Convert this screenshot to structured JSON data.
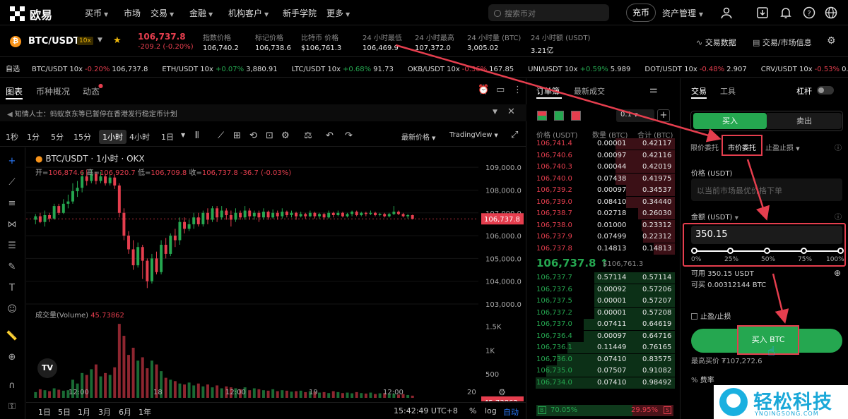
{
  "nav": {
    "brand": "欧易",
    "menu": [
      {
        "label": "买币",
        "chevron": true
      },
      {
        "label": "市场",
        "chevron": false
      },
      {
        "label": "交易",
        "chevron": true
      },
      {
        "label": "金融",
        "chevron": true
      },
      {
        "label": "机构客户",
        "chevron": true
      },
      {
        "label": "新手学院",
        "chevron": false
      },
      {
        "label": "更多",
        "chevron": true
      }
    ],
    "search_placeholder": "搜索币对",
    "deposit": "充币",
    "assets": "资产管理"
  },
  "ticker": {
    "pair": "BTC/USDT",
    "leverage": "10x",
    "price": "106,737.8",
    "change": "-209.2 (-0.20%)",
    "stats": [
      {
        "label": "指数价格",
        "value": "106,740.2"
      },
      {
        "label": "标记价格",
        "value": "106,738.6"
      },
      {
        "label": "比特币 价格",
        "value": "$106,761.3"
      },
      {
        "label": "24 小时最低",
        "value": "106,469.9"
      },
      {
        "label": "24 小时最高",
        "value": "107,372.0"
      },
      {
        "label": "24 小时量 (BTC)",
        "value": "3,005.02"
      },
      {
        "label": "24 小时额 (USDT)",
        "value": "3.21亿"
      }
    ],
    "trade_data": "交易数据",
    "trade_info": "交易/市场信息"
  },
  "watchlist": {
    "label": "自选",
    "items": [
      {
        "pair": "BTC/USDT 10x",
        "change": "-0.20%",
        "price": "106,737.8",
        "up": false
      },
      {
        "pair": "ETH/USDT 10x",
        "change": "+0.07%",
        "price": "3,880.91",
        "up": true
      },
      {
        "pair": "LTC/USDT 10x",
        "change": "+0.68%",
        "price": "91.73",
        "up": true
      },
      {
        "pair": "OKB/USDT 10x",
        "change": "-0.36%",
        "price": "167.85",
        "up": false
      },
      {
        "pair": "UNI/USDT 10x",
        "change": "+0.59%",
        "price": "5.989",
        "up": true
      },
      {
        "pair": "DOT/USDT 10x",
        "change": "-0.48%",
        "price": "2.907",
        "up": false
      },
      {
        "pair": "CRV/USDT 10x",
        "change": "-0.53%",
        "price": "0.5212",
        "up": false
      },
      {
        "pair": "AAVE/U",
        "change": "",
        "price": "",
        "up": false
      }
    ]
  },
  "chart_panel": {
    "tabs": [
      "图表",
      "币种概况",
      "动态"
    ],
    "notice": "知情人士：蚂蚁京东等已暂停在香港发行稳定币计划",
    "intervals": [
      "1秒",
      "1分",
      "5分",
      "15分",
      "1小时",
      "4小时",
      "1日"
    ],
    "active_interval": "1小时",
    "price_mode": "最新价格",
    "view_mode": "TradingView",
    "title": "BTC/USDT · 1小时 · OKX",
    "ohlc": {
      "open_label": "开=",
      "open": "106,874.6",
      "high_label": "高=",
      "high": "106,920.7",
      "low_label": "低=",
      "low": "106,709.8",
      "close_label": "收=",
      "close": "106,737.8",
      "change": "-36.7 (-0.03%)"
    },
    "volume_title": "成交量(Volume)",
    "volume_value": "45.73862",
    "price_axis": [
      "109,000.0",
      "108,000.0",
      "107,000.0",
      "106,000.0",
      "105,000.0",
      "104,000.0",
      "103,000.0"
    ],
    "current_price_tag": "106,737.8",
    "vol_axis": [
      "1.5K",
      "1K",
      "500"
    ],
    "vol_tag": "45.73862",
    "time_axis": [
      "12:00",
      "18",
      "12:00",
      "19",
      "12:00",
      "20"
    ],
    "ranges": [
      "1日",
      "5日",
      "1月",
      "3月",
      "6月",
      "1年"
    ],
    "clock": "15:42:49 UTC+8",
    "pct": "%",
    "log": "log",
    "auto": "自动"
  },
  "chart_data": {
    "type": "candlestick",
    "ylim": [
      103000,
      109500
    ],
    "candles": [
      [
        106700,
        106850,
        106500,
        106950
      ],
      [
        106850,
        106600,
        106550,
        107000
      ],
      [
        106600,
        106900,
        106400,
        107100
      ],
      [
        106900,
        106750,
        106600,
        107000
      ],
      [
        106750,
        107300,
        106700,
        107400
      ],
      [
        107300,
        107000,
        106900,
        107400
      ],
      [
        107000,
        107400,
        106950,
        107600
      ],
      [
        107400,
        107500,
        107200,
        107800
      ],
      [
        107500,
        107950,
        107400,
        108300
      ],
      [
        107950,
        108100,
        107700,
        108400
      ],
      [
        108100,
        108600,
        107900,
        108800
      ],
      [
        108600,
        108400,
        108200,
        108900
      ],
      [
        108400,
        108700,
        108300,
        108900
      ],
      [
        108700,
        108400,
        108250,
        108800
      ],
      [
        108400,
        108600,
        108300,
        108800
      ],
      [
        108600,
        108300,
        108200,
        108700
      ],
      [
        108300,
        108550,
        108200,
        108700
      ],
      [
        108550,
        108200,
        108050,
        108650
      ],
      [
        108200,
        107000,
        106800,
        108300
      ],
      [
        107000,
        106000,
        105800,
        107200
      ],
      [
        106000,
        105400,
        105200,
        106200
      ],
      [
        105400,
        104700,
        104500,
        105800
      ],
      [
        104700,
        105500,
        104600,
        105700
      ],
      [
        105500,
        104900,
        104100,
        105600
      ],
      [
        104900,
        104000,
        103700,
        105000
      ],
      [
        104000,
        105000,
        103900,
        105200
      ],
      [
        105000,
        104400,
        104300,
        105300
      ],
      [
        104400,
        105600,
        104300,
        105800
      ],
      [
        105600,
        105200,
        105000,
        105900
      ],
      [
        105200,
        106000,
        105100,
        106100
      ],
      [
        106000,
        105800,
        105500,
        106300
      ],
      [
        105800,
        106600,
        105600,
        106800
      ],
      [
        106600,
        106300,
        106100,
        106800
      ],
      [
        106300,
        106500,
        106200,
        106700
      ],
      [
        106500,
        106800,
        106300,
        107000
      ],
      [
        106800,
        106500,
        106400,
        107000
      ],
      [
        106500,
        107000,
        106400,
        107100
      ],
      [
        107000,
        106700,
        106500,
        107200
      ],
      [
        106700,
        107200,
        106600,
        107300
      ],
      [
        107200,
        106800,
        106600,
        107300
      ],
      [
        106800,
        107100,
        106700,
        107300
      ],
      [
        107100,
        106900,
        106700,
        107200
      ],
      [
        106900,
        106700,
        106400,
        107100
      ],
      [
        106700,
        107000,
        106600,
        107200
      ],
      [
        107000,
        106800,
        106700,
        107100
      ],
      [
        106800,
        107100,
        106700,
        107300
      ],
      [
        107100,
        106850,
        106700,
        107200
      ],
      [
        106850,
        107000,
        106700,
        107100
      ],
      [
        107000,
        106800,
        106600,
        107100
      ],
      [
        106800,
        107050,
        106700,
        107200
      ],
      [
        107050,
        106800,
        106700,
        107100
      ],
      [
        106800,
        107000,
        106750,
        107150
      ],
      [
        107000,
        106850,
        106700,
        107100
      ],
      [
        106850,
        107050,
        106750,
        107200
      ],
      [
        107050,
        106900,
        106800,
        107100
      ],
      [
        106900,
        107000,
        106800,
        107100
      ],
      [
        107000,
        106850,
        106700,
        107050
      ],
      [
        106850,
        106950,
        106800,
        107050
      ],
      [
        106950,
        106850,
        106750,
        107000
      ],
      [
        106850,
        107000,
        106800,
        107100
      ],
      [
        107000,
        106850,
        106750,
        107050
      ],
      [
        106850,
        106950,
        106750,
        107000
      ],
      [
        106950,
        106800,
        106700,
        107000
      ],
      [
        106800,
        107000,
        106750,
        107100
      ],
      [
        107000,
        106900,
        106800,
        107050
      ],
      [
        106900,
        107000,
        106850,
        107100
      ],
      [
        107000,
        106850,
        106800,
        107050
      ],
      [
        106850,
        106950,
        106800,
        107000
      ],
      [
        106950,
        107050,
        106850,
        107100
      ],
      [
        107050,
        106900,
        106850,
        107100
      ],
      [
        106900,
        107000,
        106850,
        107050
      ],
      [
        107000,
        106950,
        106850,
        107050
      ],
      [
        106950,
        107000,
        106900,
        107100
      ],
      [
        107000,
        106900,
        106850,
        107050
      ],
      [
        106900,
        106950,
        106850,
        107000
      ],
      [
        106950,
        106850,
        106800,
        107000
      ],
      [
        106850,
        106950,
        106800,
        107000
      ],
      [
        106950,
        107050,
        106900,
        107300
      ],
      [
        107050,
        106950,
        106900,
        107100
      ],
      [
        106950,
        106850,
        106800,
        107000
      ],
      [
        106850,
        106900,
        106750,
        106950
      ],
      [
        106900,
        106737.8,
        106709.8,
        106920.7
      ]
    ],
    "volumes": [
      120,
      180,
      160,
      140,
      200,
      170,
      150,
      160,
      380,
      300,
      520,
      480,
      600,
      700,
      450,
      520,
      480,
      640,
      1550,
      1300,
      900,
      1050,
      780,
      850,
      620,
      780,
      700,
      560,
      420,
      380,
      350,
      300,
      280,
      320,
      260,
      300,
      240,
      280,
      220,
      260,
      200,
      240,
      220,
      200,
      180,
      220,
      160,
      200,
      180,
      160,
      150,
      180,
      140,
      160,
      150,
      130,
      140,
      150,
      120,
      140,
      130,
      110,
      120,
      100,
      140,
      120,
      100,
      110,
      95,
      120,
      100,
      90,
      110,
      80,
      95,
      100,
      85,
      90,
      70,
      80,
      60,
      45.73862
    ]
  },
  "orderbook": {
    "tabs": [
      "订单簿",
      "最新成交"
    ],
    "step": "0.1",
    "headers": [
      "价格 (USDT)",
      "数量 (BTC)",
      "合计 (BTC)"
    ],
    "asks": [
      [
        "106,741.4",
        "0.00001",
        "0.42117",
        0.42117
      ],
      [
        "106,740.6",
        "0.00097",
        "0.42116",
        0.42116
      ],
      [
        "106,740.3",
        "0.00044",
        "0.42019",
        0.42019
      ],
      [
        "106,740.0",
        "0.07438",
        "0.41975",
        0.41975
      ],
      [
        "106,739.2",
        "0.00097",
        "0.34537",
        0.34537
      ],
      [
        "106,739.0",
        "0.08410",
        "0.34440",
        0.3444
      ],
      [
        "106,738.7",
        "0.02718",
        "0.26030",
        0.2603
      ],
      [
        "106,738.0",
        "0.01000",
        "0.23312",
        0.23312
      ],
      [
        "106,737.9",
        "0.07499",
        "0.22312",
        0.22312
      ],
      [
        "106,737.8",
        "0.14813",
        "0.14813",
        0.14813
      ]
    ],
    "mid_price": "106,737.8 ↑",
    "mid_sub": "$106,761.3",
    "bids": [
      [
        "106,737.7",
        "0.57114",
        "0.57114",
        0.57114
      ],
      [
        "106,737.6",
        "0.00092",
        "0.57206",
        0.57206
      ],
      [
        "106,737.5",
        "0.00001",
        "0.57207",
        0.57207
      ],
      [
        "106,737.2",
        "0.00001",
        "0.57208",
        0.57208
      ],
      [
        "106,737.0",
        "0.07411",
        "0.64619",
        0.64619
      ],
      [
        "106,736.4",
        "0.00097",
        "0.64716",
        0.64716
      ],
      [
        "106,736.1",
        "0.11449",
        "0.76165",
        0.76165
      ],
      [
        "106,736.0",
        "0.07410",
        "0.83575",
        0.83575
      ],
      [
        "106,735.0",
        "0.07507",
        "0.91082",
        0.91082
      ],
      [
        "106,734.0",
        "0.07410",
        "0.98492",
        0.98492
      ]
    ],
    "buy_ratio_label": "B",
    "buy_ratio": "70.05%",
    "sell_ratio": "29.95%",
    "sell_ratio_label": "S"
  },
  "trade": {
    "tabs": [
      "交易",
      "工具"
    ],
    "leverage_label": "杠杆",
    "buy": "买入",
    "sell": "卖出",
    "order_types": [
      "限价委托",
      "市价委托",
      "止盈止损"
    ],
    "price_label": "价格 (USDT)",
    "price_placeholder": "以当前市场最优价格下单",
    "amount_label": "金额 (USDT)",
    "amount_value": "350.15",
    "slider_marks": [
      "0%",
      "25%",
      "50%",
      "75%",
      "100%"
    ],
    "slider_level": 1.0,
    "available": "可用 350.15 USDT",
    "can_buy": "可买 0.00312144 BTC",
    "tpsl": "止盈/止损",
    "buy_button": "买入 BTC",
    "max_price": "最高买价 ₮107,272.6",
    "fee": "费率"
  },
  "watermark": {
    "text": "轻松科技",
    "url": "YNQINGSONG.COM"
  },
  "colors": {
    "up": "#25a750",
    "down": "#e53e4e",
    "highlight": "#e53e4e"
  }
}
